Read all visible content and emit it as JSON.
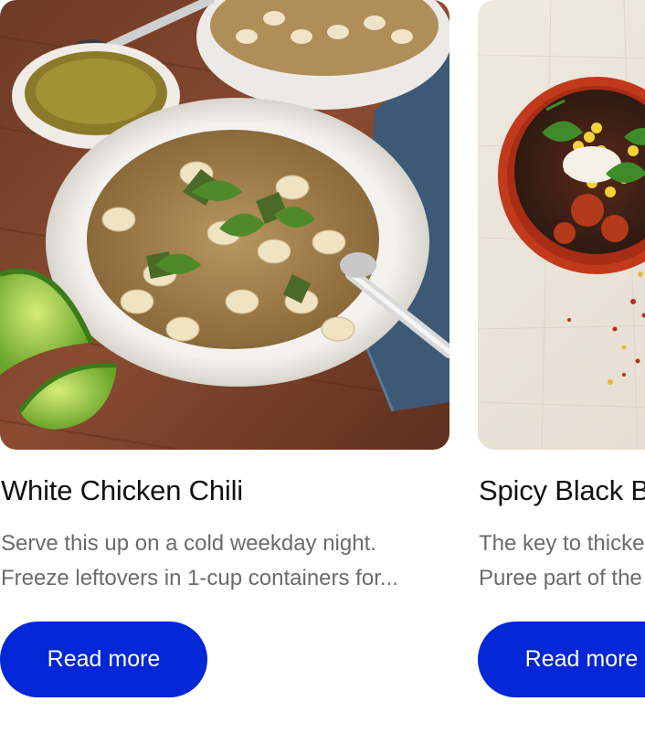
{
  "cards": [
    {
      "title": "White Chicken Chili",
      "description": "Serve this up on a cold weekday night. Freeze leftovers in 1-cup containers for...",
      "button_label": "Read more",
      "image_subject": "white-chicken-chili-photo"
    },
    {
      "title": "Spicy Black Bean Soup",
      "description": "The key to thickening this soup without flour? Puree part of the beans...",
      "button_label": "Read more",
      "image_subject": "spicy-black-bean-soup-photo"
    }
  ],
  "colors": {
    "button_background": "#0326d6",
    "button_text": "#ffffff",
    "title_text": "#111111",
    "description_text": "#6b6b6b"
  }
}
